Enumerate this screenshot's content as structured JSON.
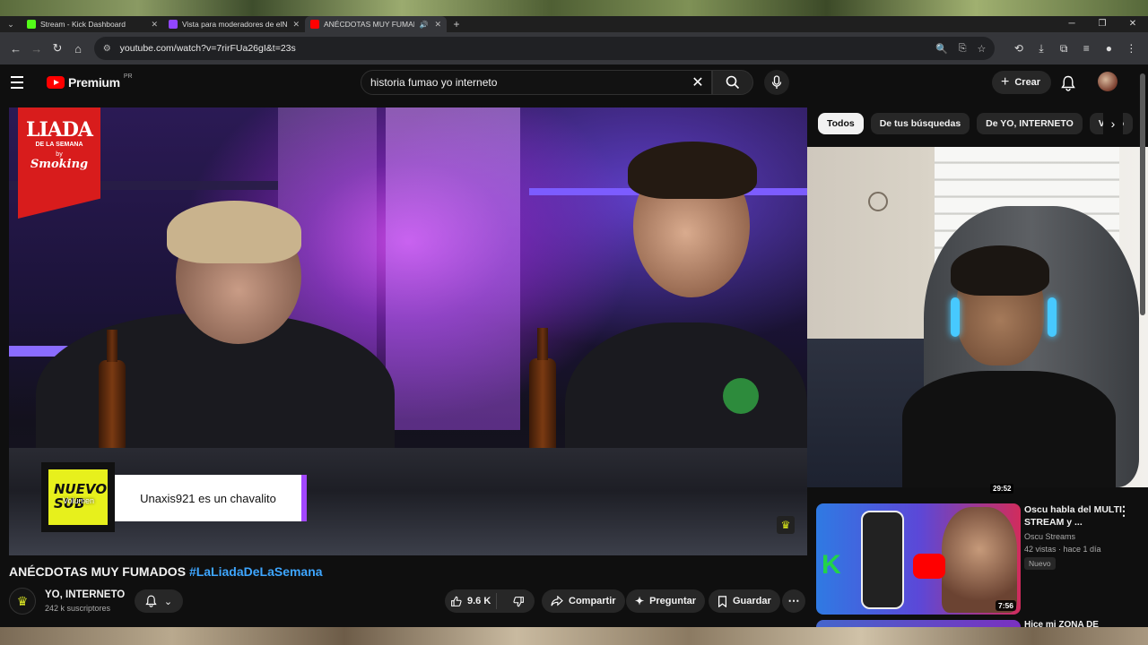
{
  "browser": {
    "tabs": [
      {
        "title": "Stream - Kick Dashboard",
        "favicon_color": "#53fc18",
        "active": false
      },
      {
        "title": "Vista para moderadores de elN",
        "favicon_color": "#9146ff",
        "active": false
      },
      {
        "title": "ANÉCDOTAS MUY FUMADC",
        "favicon_color": "#ff0000",
        "active": true
      }
    ],
    "new_tab_label": "+",
    "url": "youtube.com/watch?v=7rirFUa26gI&t=23s"
  },
  "header": {
    "logo_text": "Premium",
    "region_code": "PR",
    "search_value": "historia fumao yo interneto",
    "create_label": "Crear"
  },
  "video_overlay": {
    "logo_line1": "LIADA",
    "logo_line2": "DE LA SEMANA",
    "logo_by": "by",
    "logo_sponsor": "Smoking",
    "badge_text": "NUEVO SUB",
    "volume_tooltip": "Volumen",
    "sub_message": "Unaxis921 es un chavalito"
  },
  "chips": [
    {
      "label": "Todos",
      "active": true
    },
    {
      "label": "De tus búsquedas",
      "active": false
    },
    {
      "label": "De YO, INTERNETO",
      "active": false
    },
    {
      "label": "Video",
      "active": false
    }
  ],
  "previous_duration": "29:52",
  "recommendation": {
    "title": "Oscu habla del MULTI STREAM y ...",
    "channel": "Oscu Streams",
    "meta": "42 vistas · hace 1 día",
    "badge": "Nuevo",
    "duration": "7:56"
  },
  "next_title": "Hice mi ZONA DE",
  "video": {
    "title": "ANÉCDOTAS MUY FUMADOS",
    "hashtag": "#LaLiadaDeLaSemana",
    "channel_name": "YO, INTERNETO",
    "subscribers": "242 k suscriptores",
    "likes": "9.6 K",
    "share_label": "Compartir",
    "ask_label": "Preguntar",
    "save_label": "Guardar"
  },
  "colors": {
    "accent_red": "#ff0000",
    "link_blue": "#3ea6ff",
    "badge_yellow": "#e7f01c",
    "sub_purple": "#a247ff"
  }
}
